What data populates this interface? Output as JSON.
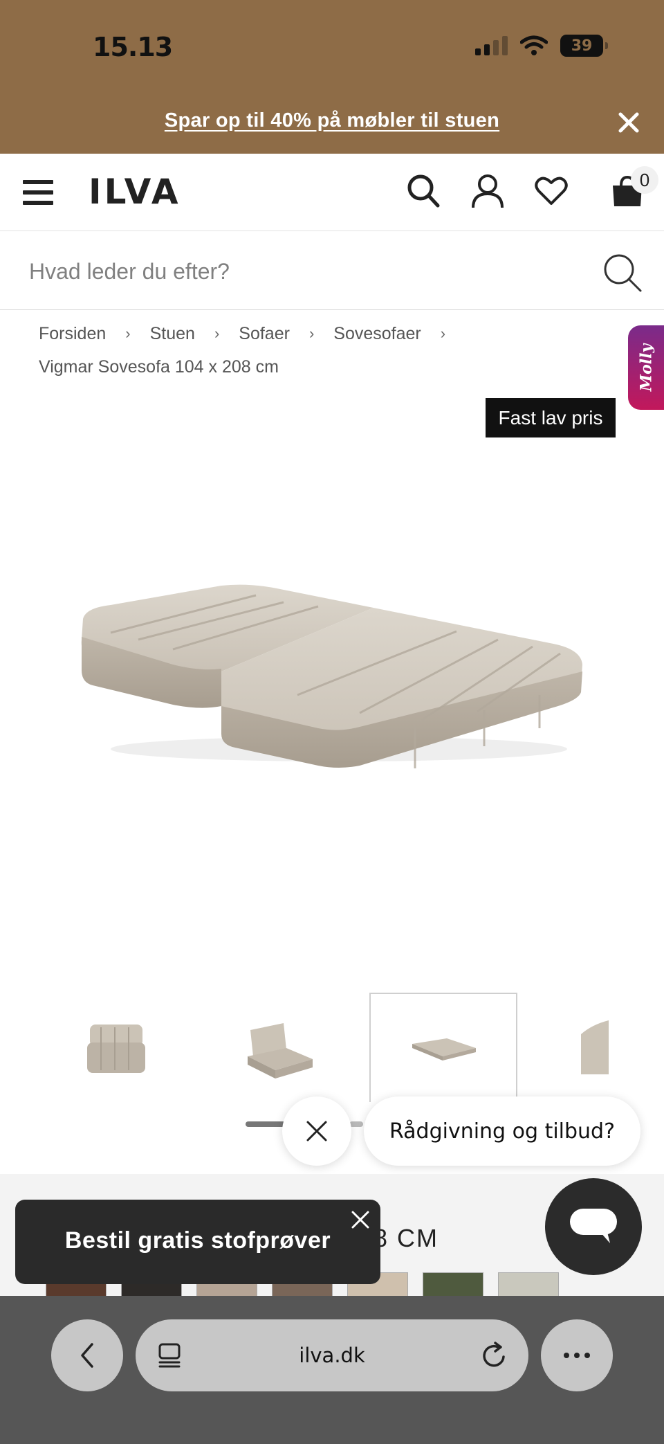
{
  "status_bar": {
    "time": "15.13",
    "battery": "39"
  },
  "promo": {
    "text": "Spar op til 40% på møbler til stuen"
  },
  "header": {
    "logo": "ILVA",
    "cart_count": "0"
  },
  "search": {
    "placeholder": "Hvad leder du efter?"
  },
  "breadcrumb": {
    "items": [
      "Forsiden",
      "Stuen",
      "Sofaer",
      "Sovesofaer"
    ],
    "current": "Vigmar Sovesofa 104 x 208 cm"
  },
  "molly": {
    "label": "Molly"
  },
  "product": {
    "badge": "Fast lav pris",
    "size_partial": "8 CM"
  },
  "chat": {
    "bubble": "Rådgivning og tilbud?"
  },
  "toast": {
    "text": "Bestil gratis stofprøver"
  },
  "swatch_colors": [
    "#5a3a2c",
    "#2d2a28",
    "#b5a495",
    "#7a6658",
    "#cfc0ad",
    "#4f5a3e",
    "#c9c8bd"
  ],
  "browser": {
    "url": "ilva.dk"
  }
}
